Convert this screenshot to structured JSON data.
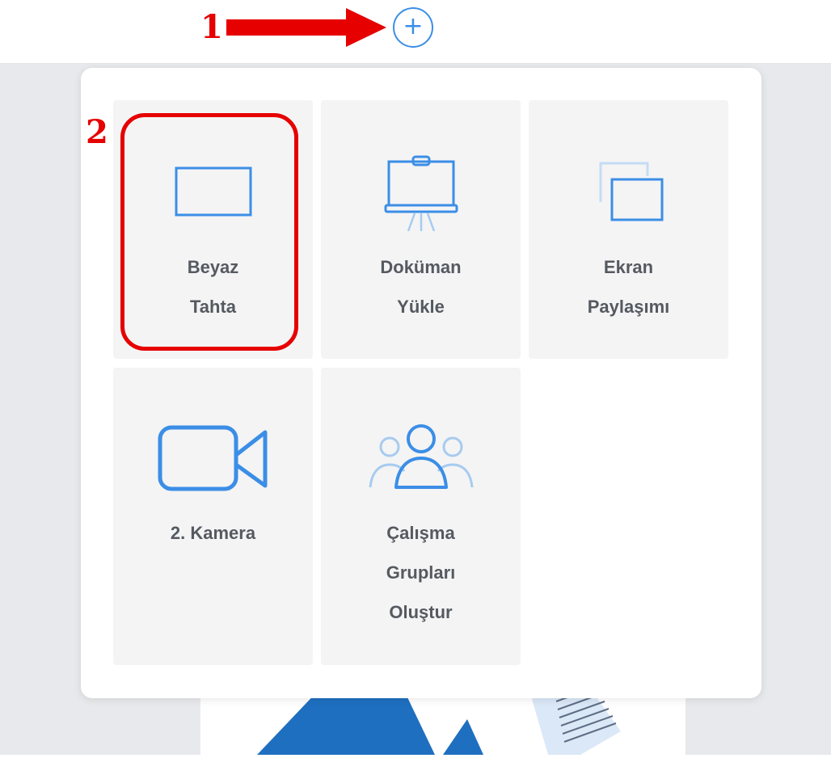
{
  "annotations": {
    "step1": "1",
    "step2": "2"
  },
  "toolbar": {
    "add_button_icon": "plus-circle-icon",
    "add_button_glyph": "+"
  },
  "menu": {
    "items": [
      {
        "lines": [
          "Beyaz",
          "Tahta"
        ],
        "icon": "whiteboard-icon"
      },
      {
        "lines": [
          "Doküman",
          "Yükle"
        ],
        "icon": "presentation-board-icon"
      },
      {
        "lines": [
          "Ekran",
          "Paylaşımı"
        ],
        "icon": "screen-share-icon"
      },
      {
        "lines": [
          "2. Kamera"
        ],
        "icon": "video-camera-icon"
      },
      {
        "lines": [
          "Çalışma",
          "Grupları",
          "Oluştur"
        ],
        "icon": "group-users-icon"
      }
    ]
  },
  "colors": {
    "accent_blue": "#3b8ee6",
    "annotation_red": "#e60000",
    "tile_bg": "#f4f4f5",
    "label_text": "#555a60"
  }
}
